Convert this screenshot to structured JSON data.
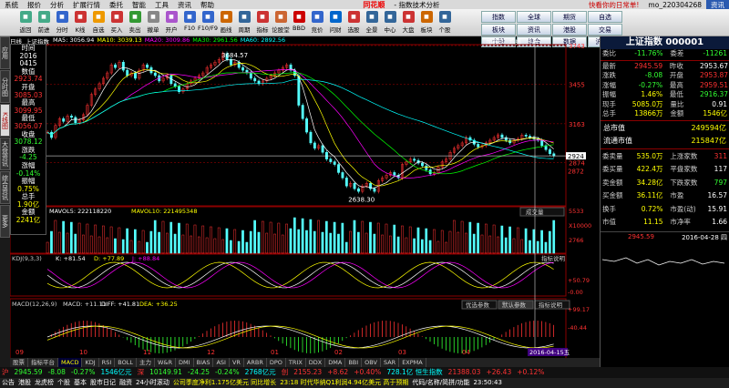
{
  "menu": {
    "items": [
      "系统",
      "报价",
      "分析",
      "扩展行情",
      "委托",
      "智能",
      "工具",
      "资讯",
      "帮助"
    ],
    "brand": "同花顺",
    "title": "- 指数技术分析",
    "alert": "快看你的日常单!",
    "user": "mo_220304268",
    "tabs": [
      "资讯"
    ]
  },
  "toolbar": {
    "buttons": [
      {
        "label": "返回",
        "icon": "back-icon"
      },
      {
        "label": "前进",
        "icon": "forward-icon"
      },
      {
        "label": "分时",
        "icon": "clock-icon"
      },
      {
        "label": "K线",
        "icon": "candle-icon"
      },
      {
        "label": "自选",
        "icon": "star-icon"
      },
      {
        "label": "买入",
        "icon": "buy-icon"
      },
      {
        "label": "卖出",
        "icon": "sell-icon"
      },
      {
        "label": "撤单",
        "icon": "cancel-icon"
      },
      {
        "label": "开户",
        "icon": "user-icon"
      },
      {
        "label": "F10",
        "icon": "f10-icon"
      },
      {
        "label": "F10/F9",
        "icon": "f9-icon"
      },
      {
        "label": "画线",
        "icon": "pen-icon"
      },
      {
        "label": "周期",
        "icon": "cycle-icon"
      },
      {
        "label": "指标",
        "icon": "indicator-icon"
      },
      {
        "label": "论股堂",
        "icon": "chat-icon"
      },
      {
        "label": "BBD",
        "icon": "bbd-icon"
      },
      {
        "label": "竞价",
        "icon": "bid-icon"
      },
      {
        "label": "问财",
        "icon": "ask-icon"
      },
      {
        "label": "选股",
        "icon": "pick-icon"
      },
      {
        "label": "全景",
        "icon": "panorama-icon"
      },
      {
        "label": "中心",
        "icon": "center-icon"
      },
      {
        "label": "大盘",
        "icon": "index-icon"
      },
      {
        "label": "板块",
        "icon": "sector-icon"
      },
      {
        "label": "个股",
        "icon": "stock-icon"
      }
    ],
    "nav": [
      "指数",
      "全球",
      "期货",
      "自选",
      "板块",
      "资讯",
      "港股",
      "交易",
      "个股",
      "综合",
      "数据",
      "沪港通"
    ]
  },
  "left_tabs": [
    {
      "label": "应用",
      "on": false
    },
    {
      "label": "分时图",
      "on": false
    },
    {
      "label": "K线图",
      "on": true
    },
    {
      "label": "大盘资讯",
      "on": false
    },
    {
      "label": "综合资讯",
      "on": false
    },
    {
      "label": "更多",
      "on": false
    }
  ],
  "info_panel": [
    {
      "k": "时间",
      "v": "2016"
    },
    {
      "k": "",
      "v": "0415"
    },
    {
      "k": "",
      "v": "数值"
    },
    {
      "k": "",
      "v": "2923.74",
      "c": "red"
    },
    {
      "k": "开盘",
      "v": "3085.03",
      "c": "red"
    },
    {
      "k": "最高",
      "v": "3099.95",
      "c": "red"
    },
    {
      "k": "最低",
      "v": "3056.07",
      "c": "red"
    },
    {
      "k": "收盘",
      "v": "3078.12",
      "c": "grn"
    },
    {
      "k": "涨跌",
      "v": "-4.25",
      "c": "grn"
    },
    {
      "k": "涨幅",
      "v": "-0.14%",
      "c": "grn"
    },
    {
      "k": "振幅",
      "v": "0.75%",
      "c": "yel"
    },
    {
      "k": "总手",
      "v": "1.90亿",
      "c": "yel"
    },
    {
      "k": "金额",
      "v": "2241亿",
      "c": "yel"
    }
  ],
  "chart_header": {
    "name": "日线",
    "index": "上证指数",
    "ma": [
      {
        "label": "MA5: 3056.94",
        "c": "#fff"
      },
      {
        "label": "MA10: 3039.13",
        "c": "#ff0"
      },
      {
        "label": "MA20: 3009.86",
        "c": "#f0f"
      },
      {
        "label": "MA30: 2961.56",
        "c": "#0f0"
      },
      {
        "label": "MA60: 2892.56",
        "c": "#0ff"
      }
    ],
    "right_btns": [
      "加自选",
      "坞线",
      "排附"
    ]
  },
  "chart_data": [
    {
      "type": "candlestick",
      "title": "上证指数 日线",
      "y_ticks": [
        3743,
        3455,
        3163,
        2874,
        2872
      ],
      "x_ticks": [
        "09",
        "10",
        "11",
        "12",
        "01",
        "02",
        "03",
        "04"
      ],
      "annotations": [
        "3684.57",
        "2638.30"
      ],
      "last_price": 2924,
      "closes": [
        3100,
        3060,
        3150,
        3200,
        3180,
        3220,
        3210,
        3170,
        3190,
        3230,
        3300,
        3380,
        3420,
        3460,
        3500,
        3540,
        3600,
        3580,
        3620,
        3560,
        3520,
        3540,
        3500,
        3560,
        3600,
        3580,
        3540,
        3520,
        3480,
        3500,
        3520,
        3460,
        3440,
        3400,
        3420,
        3460,
        3480,
        3500,
        3520,
        3540,
        3580,
        3600,
        3620,
        3640,
        3684,
        3640,
        3600,
        3620,
        3580,
        3560,
        3540,
        3500,
        3480,
        3460,
        3480,
        3500,
        3520,
        3540,
        3560,
        3580,
        3600,
        3560,
        3520,
        3300,
        3200,
        3100,
        3020,
        2980,
        3000,
        2950,
        2900,
        2880,
        2860,
        2800,
        2760,
        2700,
        2720,
        2680,
        2660,
        2700,
        2720,
        2680,
        2660,
        2740,
        2760,
        2780,
        2800,
        2780,
        2760,
        2860,
        2880,
        2900,
        2890,
        2870,
        2850,
        2820,
        2790,
        2800,
        2840,
        2880,
        2900,
        2950,
        2980,
        3000,
        3020,
        3060,
        3040,
        3010,
        2990,
        3000,
        3020,
        3040,
        3060,
        3080,
        3060,
        3040,
        3020,
        3040,
        3050,
        3078,
        3070,
        3060,
        3050,
        3040,
        3000,
        2970,
        2940,
        2924
      ]
    },
    {
      "type": "bar",
      "title": "VOL",
      "legend": [
        "MAVOL5: 222118220",
        "MAVOL10: 221495348"
      ],
      "ylabel_ticks": [
        "5533",
        "X10000",
        "2766"
      ],
      "button": "成交量"
    },
    {
      "type": "line",
      "title": "KDJ(9,3,3)",
      "legend": [
        {
          "label": "K: +81.54",
          "c": "#fff"
        },
        {
          "label": "D: +77.89",
          "c": "#ff0"
        },
        {
          "label": "J: +88.84",
          "c": "#f0f"
        }
      ],
      "y_ticks": [
        "+50.79",
        "-0.00"
      ],
      "button": "指标说明"
    },
    {
      "type": "bar",
      "title": "MACD(12,26,9)",
      "legend": [
        {
          "label": "MACD: +11.11",
          "c": "#ddd"
        },
        {
          "label": "DIFF: +41.81",
          "c": "#fff"
        },
        {
          "label": "DEA: +36.25",
          "c": "#ff0"
        }
      ],
      "y_ticks": [
        "+99.17",
        "-40.44"
      ],
      "buttons": [
        "优选参数",
        "默认参数",
        "指标说明"
      ],
      "cursor_date": "2016-04-15五"
    }
  ],
  "right_panel": {
    "title": "上证指数 000001",
    "weibi": [
      {
        "l": "委比",
        "v": "-11.76%",
        "c": "grn",
        "l2": "委差",
        "v2": "-11261",
        "c2": "grn"
      }
    ],
    "quote": [
      {
        "l": "最新",
        "v": "2945.59",
        "c": "red",
        "l2": "昨收",
        "v2": "2953.67",
        "c2": "wht"
      },
      {
        "l": "涨跌",
        "v": "-8.08",
        "c": "grn",
        "l2": "开盘",
        "v2": "2953.87",
        "c2": "red"
      },
      {
        "l": "涨幅",
        "v": "-0.27%",
        "c": "grn",
        "l2": "最高",
        "v2": "2959.51",
        "c2": "red"
      },
      {
        "l": "振幅",
        "v": "1.46%",
        "c": "yel",
        "l2": "最低",
        "v2": "2916.37",
        "c2": "grn"
      },
      {
        "l": "现手",
        "v": "5085.0万",
        "c": "yel",
        "l2": "量比",
        "v2": "0.91",
        "c2": "wht"
      },
      {
        "l": "总手",
        "v": "13866万",
        "c": "yel",
        "l2": "金额",
        "v2": "1546亿",
        "c2": "yel"
      }
    ],
    "market": [
      {
        "l": "总市值",
        "v": "249594亿",
        "c": "yel"
      },
      {
        "l": "流通市值",
        "v": "215847亿",
        "c": "yel"
      }
    ],
    "trade": [
      {
        "l": "委卖量",
        "v": "535.0万",
        "c": "yel",
        "l2": "上涨家数",
        "v2": "311",
        "c2": "red"
      },
      {
        "l": "委买量",
        "v": "422.4万",
        "c": "yel",
        "l2": "平盘家数",
        "v2": "117",
        "c2": "wht"
      },
      {
        "l": "卖金额",
        "v": "34.28亿",
        "c": "yel",
        "l2": "下跌家数",
        "v2": "797",
        "c2": "grn"
      },
      {
        "l": "买金额",
        "v": "36.11亿",
        "c": "yel",
        "l2": "市盈",
        "v2": "16.57",
        "c2": "wht"
      },
      {
        "l": "换手",
        "v": "0.72%",
        "c": "yel",
        "l2": "市盈(动)",
        "v2": "15.91",
        "c2": "wht"
      },
      {
        "l": "市值",
        "v": "11.15",
        "c": "yel",
        "l2": "市净率",
        "v2": "1.66",
        "c2": "wht"
      }
    ],
    "mini": {
      "price": "2945.59",
      "date": "2016-04-28 四"
    }
  },
  "bottom_tabs": [
    {
      "label": "股票",
      "on": false
    },
    {
      "label": "指标平台",
      "on": false
    },
    {
      "label": "MACD",
      "on": true
    },
    {
      "label": "KDJ",
      "on": false
    },
    {
      "label": "RSI",
      "on": false
    },
    {
      "label": "BOLL",
      "on": false
    },
    {
      "label": "主力",
      "on": false
    },
    {
      "label": "W&R",
      "on": false
    },
    {
      "label": "DMI",
      "on": false
    },
    {
      "label": "BIAS",
      "on": false
    },
    {
      "label": "ASI",
      "on": false
    },
    {
      "label": "VR",
      "on": false
    },
    {
      "label": "ARBR",
      "on": false
    },
    {
      "label": "DPO",
      "on": false
    },
    {
      "label": "TRIX",
      "on": false
    },
    {
      "label": "DDX",
      "on": false
    },
    {
      "label": "DMA",
      "on": false
    },
    {
      "label": "BBI",
      "on": false
    },
    {
      "label": "OBV",
      "on": false
    },
    {
      "label": "SAR",
      "on": false
    },
    {
      "label": "EXPMA",
      "on": false
    }
  ],
  "status": [
    {
      "t": "沪",
      "c": "red"
    },
    {
      "t": "2945.59",
      "c": "grn"
    },
    {
      "t": "-8.08",
      "c": "grn"
    },
    {
      "t": "-0.27%",
      "c": "grn"
    },
    {
      "t": "1546亿元",
      "c": "cyn"
    },
    {
      "t": "深",
      "c": "red"
    },
    {
      "t": "10149.91",
      "c": "grn"
    },
    {
      "t": "-24.25",
      "c": "grn"
    },
    {
      "t": "-0.24%",
      "c": "grn"
    },
    {
      "t": "2768亿元",
      "c": "cyn"
    },
    {
      "t": "创",
      "c": "red"
    },
    {
      "t": "2155.23",
      "c": "red"
    },
    {
      "t": "+8.62",
      "c": "red"
    },
    {
      "t": "+0.40%",
      "c": "red"
    },
    {
      "t": "728.1亿 恒生指数",
      "c": "cyn"
    },
    {
      "t": "21388.03",
      "c": "red"
    },
    {
      "t": "+26.43",
      "c": "red"
    },
    {
      "t": "+0.12%",
      "c": "red"
    }
  ],
  "bottom_bar": [
    {
      "t": "公告",
      "c": "wht"
    },
    {
      "t": "港股",
      "c": "wht"
    },
    {
      "t": "龙虎榜",
      "c": "wht"
    },
    {
      "t": "个股",
      "c": "wht"
    },
    {
      "t": "基本",
      "c": "wht"
    },
    {
      "t": "股市日记",
      "c": "wht"
    },
    {
      "t": "融资",
      "c": "wht"
    },
    {
      "t": "24小时滚动",
      "c": "wht"
    },
    {
      "t": "公司季度净利1.175亿美元 同比增长",
      "c": "yel"
    },
    {
      "t": "23:18 时代华纳Q1利润4.94亿美元 高于预期",
      "c": "yel"
    },
    {
      "t": "代码/名称/简拼/功能",
      "c": "wht"
    },
    {
      "t": "23:50:43",
      "c": "wht"
    }
  ]
}
